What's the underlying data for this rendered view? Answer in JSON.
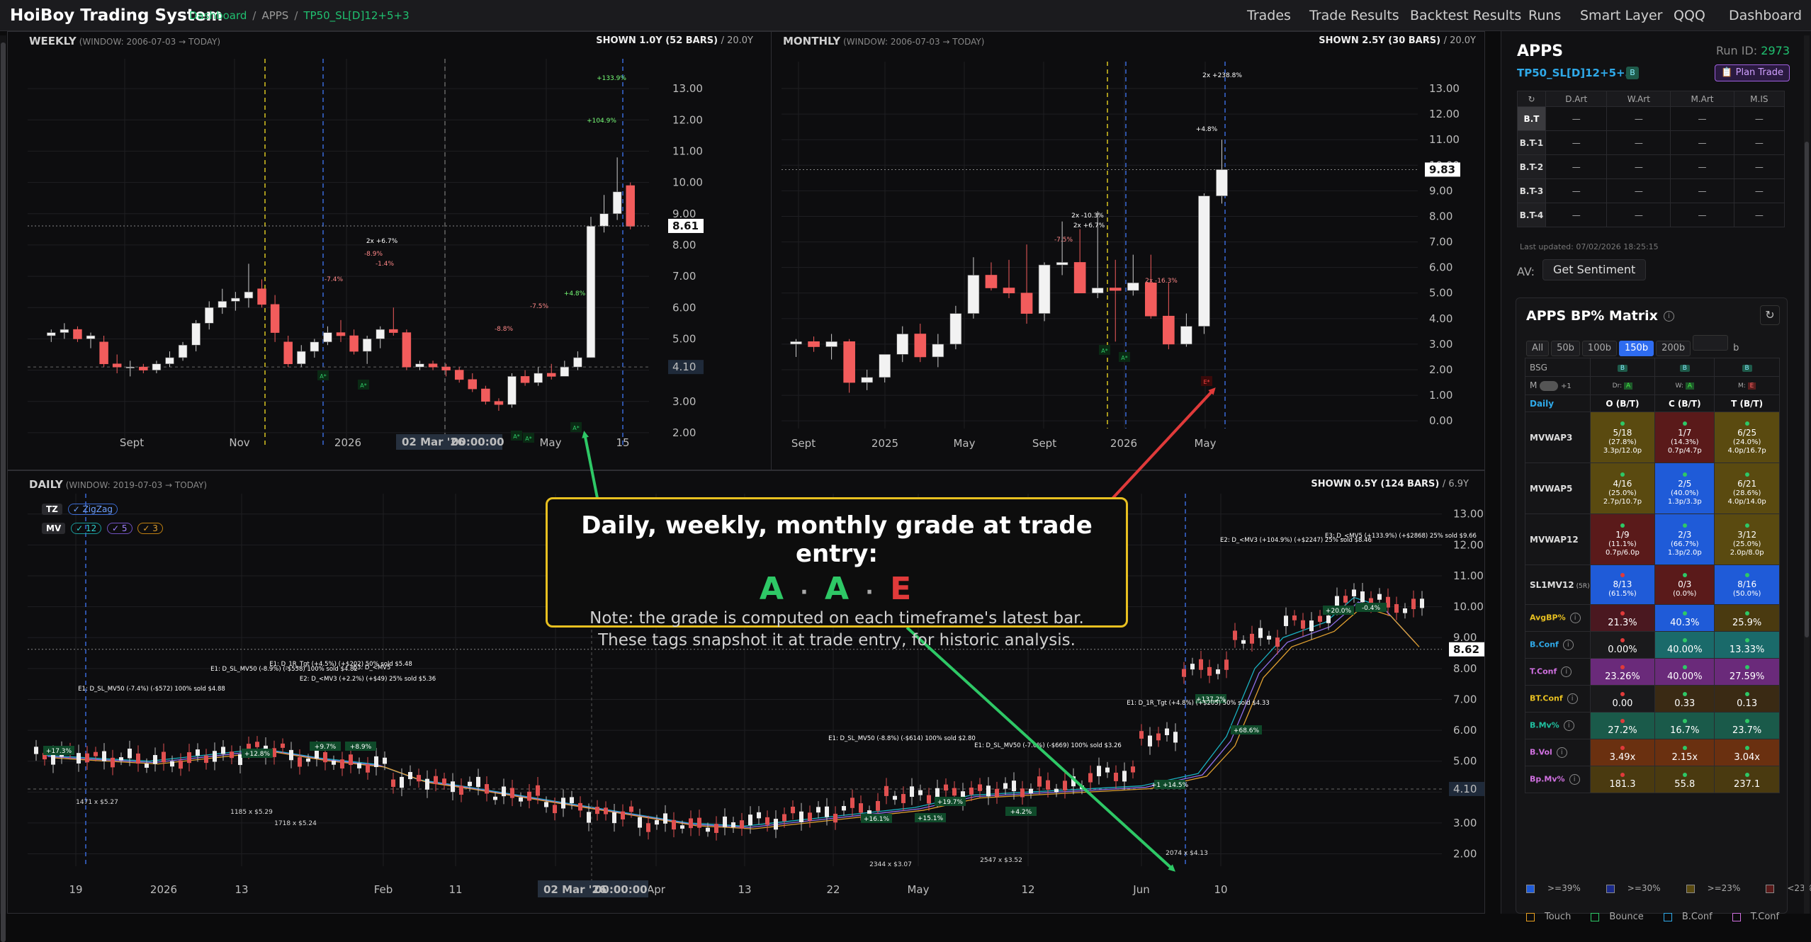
{
  "app": {
    "brand": "HoiBoy Trading System",
    "crumb_dashboard": "Dashboard",
    "crumb_apps": "APPS",
    "crumb_strategy": "TP50_SL[D]12+5+3"
  },
  "nav": [
    "Trades",
    "Trade Results",
    "Backtest Results",
    "Runs",
    "Smart Layer",
    "QQQ",
    "Dashboard"
  ],
  "weekly": {
    "title": "WEEKLY",
    "window": "(WINDOW: 2006-07-03 → TODAY)",
    "shown": "SHOWN 1.0Y (52 BARS)",
    "span": "/ 20.0Y",
    "last_price": "8.61",
    "level": "4.10",
    "crosshair_date": "02 Mar '26",
    "crosshair_time": "00:00:00"
  },
  "monthly": {
    "title": "MONTHLY",
    "window": "(WINDOW: 2006-07-03 → TODAY)",
    "shown": "SHOWN 2.5Y (30 BARS)",
    "span": "/ 20.0Y",
    "last_price": "9.83"
  },
  "daily": {
    "title": "DAILY",
    "window": "(WINDOW: 2019-07-03 → TODAY)",
    "shown": "SHOWN 0.5Y (124 BARS)",
    "span": "/ 6.9Y",
    "last_price": "8.62",
    "level": "4.10",
    "crosshair_date": "02 Mar '26",
    "crosshair_time": "00:00:00",
    "tags": {
      "tz": "TZ",
      "zigzag": "✓ ZigZag",
      "mv": "MV",
      "mv12": "✓ 12",
      "mv5": "✓ 5",
      "mv3": "✓ 3"
    }
  },
  "callout": {
    "heading": "Daily, weekly, monthly grade at trade entry:",
    "grade_daily": "A",
    "grade_weekly": "A",
    "grade_monthly": "E",
    "dot": "·",
    "note1": "Note: the grade is computed on each timeframe's latest bar.",
    "note2": "These tags snapshot it at trade entry, for historic analysis.",
    "color_a": "#2ec866",
    "color_e": "#e03a3a"
  },
  "chart_data": [
    {
      "id": "weekly",
      "type": "candlestick",
      "title": "WEEKLY",
      "x_ticks": [
        "Sept",
        "Nov",
        "2026",
        "May",
        "15"
      ],
      "y_ticks": [
        "2.00",
        "3.00",
        "4.00",
        "5.00",
        "6.00",
        "7.00",
        "8.00",
        "9.00",
        "10.00",
        "11.00",
        "12.00",
        "13.00"
      ],
      "ylim": [
        1.5,
        13.5
      ],
      "candles": [
        [
          5.1,
          5.3,
          4.9,
          5.2
        ],
        [
          5.2,
          5.5,
          5.0,
          5.3
        ],
        [
          5.3,
          5.4,
          4.9,
          5.0
        ],
        [
          5.0,
          5.2,
          4.7,
          5.1
        ],
        [
          4.9,
          5.1,
          4.1,
          4.2
        ],
        [
          4.2,
          4.5,
          3.9,
          4.1
        ],
        [
          4.1,
          4.3,
          3.8,
          4.1
        ],
        [
          4.1,
          4.2,
          3.9,
          4.0
        ],
        [
          4.0,
          4.3,
          3.9,
          4.2
        ],
        [
          4.2,
          4.6,
          4.1,
          4.4
        ],
        [
          4.4,
          4.9,
          4.3,
          4.8
        ],
        [
          4.8,
          5.6,
          4.6,
          5.5
        ],
        [
          5.5,
          6.2,
          5.3,
          6.0
        ],
        [
          6.0,
          6.6,
          5.8,
          6.2
        ],
        [
          6.2,
          6.5,
          5.9,
          6.3
        ],
        [
          6.3,
          7.4,
          6.0,
          6.5
        ],
        [
          6.6,
          6.9,
          6.0,
          6.1
        ],
        [
          6.1,
          6.4,
          4.9,
          5.2
        ],
        [
          4.9,
          5.1,
          4.1,
          4.2
        ],
        [
          4.2,
          4.8,
          4.1,
          4.6
        ],
        [
          4.6,
          5.0,
          4.4,
          4.9
        ],
        [
          4.9,
          5.4,
          4.8,
          5.2
        ],
        [
          5.2,
          5.6,
          4.9,
          5.1
        ],
        [
          5.1,
          5.3,
          4.5,
          4.6
        ],
        [
          4.6,
          5.1,
          4.2,
          5.0
        ],
        [
          5.0,
          5.4,
          4.7,
          5.3
        ],
        [
          5.3,
          6.0,
          5.1,
          5.2
        ],
        [
          5.2,
          5.3,
          4.0,
          4.1
        ],
        [
          4.1,
          4.3,
          4.0,
          4.2
        ],
        [
          4.2,
          4.3,
          4.0,
          4.1
        ],
        [
          4.1,
          4.2,
          3.8,
          4.0
        ],
        [
          4.0,
          4.1,
          3.6,
          3.7
        ],
        [
          3.7,
          3.9,
          3.3,
          3.4
        ],
        [
          3.4,
          3.5,
          2.9,
          3.0
        ],
        [
          3.0,
          3.1,
          2.7,
          2.9
        ],
        [
          2.9,
          3.9,
          2.8,
          3.8
        ],
        [
          3.8,
          4.0,
          3.5,
          3.6
        ],
        [
          3.6,
          4.1,
          3.5,
          3.9
        ],
        [
          3.9,
          4.2,
          3.7,
          3.8
        ],
        [
          3.8,
          4.3,
          3.8,
          4.1
        ],
        [
          4.1,
          4.6,
          4.0,
          4.4
        ],
        [
          4.4,
          8.9,
          4.4,
          8.6
        ],
        [
          8.6,
          9.6,
          8.4,
          9.0
        ],
        [
          9.0,
          10.8,
          8.8,
          9.7
        ],
        [
          9.9,
          10.0,
          8.5,
          8.6
        ]
      ],
      "annotations": [
        "-7.4%",
        "2x +6.7%",
        "-8.9%",
        "-1.4%",
        "-7.5%",
        "-8.8%",
        "+4.8%",
        "+104.9%",
        "+133.9%"
      ]
    },
    {
      "id": "monthly",
      "type": "candlestick",
      "title": "MONTHLY",
      "x_ticks": [
        "Sept",
        "2025",
        "May",
        "Sept",
        "2026",
        "May"
      ],
      "y_ticks": [
        "0.00",
        "1.00",
        "2.00",
        "3.00",
        "4.00",
        "5.00",
        "6.00",
        "7.00",
        "8.00",
        "9.00",
        "10.00",
        "11.00",
        "12.00",
        "13.00"
      ],
      "ylim": [
        -0.3,
        13.5
      ],
      "candles": [
        [
          3.0,
          3.2,
          2.5,
          3.1
        ],
        [
          3.1,
          3.3,
          2.7,
          2.9
        ],
        [
          2.9,
          3.4,
          2.4,
          3.1
        ],
        [
          3.1,
          3.2,
          1.1,
          1.5
        ],
        [
          1.5,
          2.0,
          1.2,
          1.7
        ],
        [
          1.7,
          2.5,
          1.5,
          2.6
        ],
        [
          2.6,
          3.7,
          2.3,
          3.4
        ],
        [
          3.4,
          3.8,
          2.3,
          2.5
        ],
        [
          2.5,
          3.4,
          2.1,
          3.0
        ],
        [
          3.0,
          4.5,
          2.8,
          4.2
        ],
        [
          4.2,
          6.4,
          4.0,
          5.7
        ],
        [
          5.7,
          6.2,
          5.1,
          5.2
        ],
        [
          5.2,
          6.3,
          4.8,
          5.0
        ],
        [
          5.0,
          6.9,
          3.8,
          4.2
        ],
        [
          4.2,
          6.2,
          3.9,
          6.1
        ],
        [
          6.1,
          7.8,
          5.7,
          6.2
        ],
        [
          6.2,
          7.5,
          5.5,
          5.0
        ],
        [
          5.0,
          8.2,
          4.8,
          5.2
        ],
        [
          5.2,
          6.3,
          3.1,
          5.1
        ],
        [
          5.1,
          6.5,
          4.9,
          5.4
        ],
        [
          5.4,
          6.5,
          4.0,
          4.1
        ],
        [
          4.1,
          5.4,
          2.8,
          3.0
        ],
        [
          3.0,
          4.2,
          2.9,
          3.7
        ],
        [
          3.7,
          8.9,
          3.4,
          8.8
        ],
        [
          8.8,
          11.0,
          8.5,
          9.83
        ]
      ],
      "annotations": [
        "-7.5%",
        "2x -10.3%",
        "2x +6.7%",
        "2x -16.3%",
        "+4.8%",
        "2x +238.8%"
      ]
    },
    {
      "id": "daily",
      "type": "candlestick",
      "title": "DAILY",
      "x_ticks": [
        "19",
        "2026",
        "13",
        "Feb",
        "11",
        "20",
        "Apr",
        "13",
        "22",
        "May",
        "12",
        "Jun",
        "10"
      ],
      "y_ticks": [
        "2.00",
        "3.00",
        "4.00",
        "5.00",
        "6.00",
        "7.00",
        "8.00",
        "9.00",
        "10.00",
        "11.00",
        "12.00",
        "13.00"
      ],
      "ylim": [
        1.6,
        13.2
      ],
      "annotations": [
        "+17.3%",
        "+12.8%",
        "+9.7%",
        "+8.9%",
        "+16.1%",
        "+15.1%",
        "+19.7%",
        "+4.2%",
        "+1 +14.5%",
        "+137.2%",
        "+68.6%",
        "+20.0%",
        "-0.4%"
      ],
      "trade_labels": [
        "E1: D_SL_MV50 (-7.4%) (-$572) 100% sold $4.88",
        "E1: D_SL_MV50 (-8.9%) (-$558) 100% sold $4.82",
        "E1: D_1R_Tgt (+4.5%) (+$202) 50% sold $5.48",
        "E2: D_<MV3 (+2.2%) (+$49) 25% sold $5.36",
        "E3: D_<MV5",
        "E1: D_SL_MV50 (-8.8%) (-$614) 100% sold $2.80",
        "E1: D_SL_MV50 (-7.0%) (-$669) 100% sold $3.26",
        "E1: D_1R_Tgt (+4.8%) (+$205) 50% sold $4.33",
        "E2: D_<MV3 (+104.9%) (+$2247) 25% sold $8.46",
        "E3: D_<MV5 (+133.9%) (+$2868) 25% sold $9.66"
      ],
      "entries": [
        "1471 x $5.27",
        "1185 x $5.29",
        "1718 x $5.24",
        "2344 x $3.07",
        "2547 x $3.52",
        "2074 x $4.13"
      ]
    }
  ],
  "side": {
    "title": "APPS",
    "run_label": "Run ID:",
    "run_id": "2973",
    "strategy": "TP50_SL[D]12+5+3",
    "b_badge": "B",
    "plan_btn": "📋 Plan Trade",
    "ct_headers": [
      "↻",
      "D.Art",
      "W.Art",
      "M.Art",
      "M.IS"
    ],
    "ct_rows": [
      [
        "B.T",
        "—",
        "—",
        "—",
        "—"
      ],
      [
        "B.T-1",
        "—",
        "—",
        "—",
        "—"
      ],
      [
        "B.T-2",
        "—",
        "—",
        "—",
        "—"
      ],
      [
        "B.T-3",
        "—",
        "—",
        "—",
        "—"
      ],
      [
        "B.T-4",
        "—",
        "—",
        "—",
        "—"
      ]
    ],
    "updated": "Last updated: 07/02/2026 18:25:15",
    "av": "AV:",
    "sentiment_btn": "Get Sentiment",
    "matrix_title": "APPS BP% Matrix",
    "tabs": [
      "All",
      "50b",
      "100b",
      "150b",
      "200b"
    ],
    "tab_unit": "b",
    "bsg": "BSG",
    "m_label": "M",
    "m_plus": "+1",
    "daily_lbl": "Daily",
    "col_o": "O (B/T)",
    "col_c": "C (B/T)",
    "col_t": "T (B/T)",
    "grade_d": "Dr",
    "grade_d_v": "A",
    "grade_w": "W",
    "grade_w_v": "A",
    "grade_m": "M",
    "grade_m_v": "E",
    "rows": [
      {
        "label": "MVWAP3",
        "cells": [
          [
            "5/18",
            "(27.8%)",
            "3.3p/12.0p"
          ],
          [
            "1/7",
            "(14.3%)",
            "0.7p/4.7p"
          ],
          [
            "6/25",
            "(24.0%)",
            "4.0p/16.7p"
          ]
        ],
        "bg": [
          "#5a4a10",
          "#5a1a1a",
          "#5a4a10"
        ]
      },
      {
        "label": "MVWAP5",
        "cells": [
          [
            "4/16",
            "(25.0%)",
            "2.7p/10.7p"
          ],
          [
            "2/5",
            "(40.0%)",
            "1.3p/3.3p"
          ],
          [
            "6/21",
            "(28.6%)",
            "4.0p/14.0p"
          ]
        ],
        "bg": [
          "#5a4a10",
          "#1f5bd8",
          "#5a4a10"
        ]
      },
      {
        "label": "MVWAP12",
        "cells": [
          [
            "1/9",
            "(11.1%)",
            "0.7p/6.0p"
          ],
          [
            "2/3",
            "(66.7%)",
            "1.3p/2.0p"
          ],
          [
            "3/12",
            "(25.0%)",
            "2.0p/8.0p"
          ]
        ],
        "bg": [
          "#5a1a1a",
          "#1f5bd8",
          "#5a4a10"
        ]
      },
      {
        "label": "SL1MV12",
        "sub": "(5R)",
        "cells": [
          [
            "8/13",
            "(61.5%)",
            ""
          ],
          [
            "0/3",
            "(0.0%)",
            ""
          ],
          [
            "8/16",
            "(50.0%)",
            ""
          ]
        ],
        "bg": [
          "#1f5bd8",
          "#5a1a1a",
          "#1f5bd8"
        ]
      }
    ],
    "stats": [
      {
        "label": "AvgBP%",
        "vals": [
          "21.3%",
          "40.3%",
          "25.9%"
        ],
        "bg": [
          "#4a1820",
          "#1f5bd8",
          "#4a3a10"
        ],
        "lc": "#e8c020"
      },
      {
        "label": "B.Conf",
        "vals": [
          "0.00%",
          "40.00%",
          "13.33%"
        ],
        "bg": [
          "#1a1a1c",
          "#1a6a6a",
          "#1a6a6a"
        ],
        "lc": "#2fa9e8"
      },
      {
        "label": "T.Conf",
        "vals": [
          "23.26%",
          "40.00%",
          "27.59%"
        ],
        "bg": [
          "#6a2a7a",
          "#6a2a7a",
          "#6a2a7a"
        ],
        "lc": "#d070e0"
      },
      {
        "label": "BT.Conf",
        "vals": [
          "0.00",
          "0.33",
          "0.13"
        ],
        "bg": [
          "#1a1a1c",
          "#3a2a14",
          "#3a2a14"
        ],
        "lc": "#e8c020"
      },
      {
        "label": "B.Mv%",
        "vals": [
          "27.2%",
          "16.7%",
          "23.7%"
        ],
        "bg": [
          "#1a5a4a",
          "#1a5a4a",
          "#1a5a4a"
        ],
        "lc": "#20c0a0"
      },
      {
        "label": "B.Vol",
        "vals": [
          "3.49x",
          "2.15x",
          "3.04x"
        ],
        "bg": [
          "#6a3010",
          "#6a3010",
          "#6a3010"
        ],
        "lc": "#d070e0"
      },
      {
        "label": "Bp.Mv%",
        "vals": [
          "181.3",
          "55.8",
          "237.1"
        ],
        "bg": [
          "#4a3a10",
          "#4a3a10",
          "#4a3a10"
        ],
        "lc": "#d070e0"
      }
    ],
    "legend1": [
      ">=39%",
      ">=30%",
      ">=23%",
      "<23%"
    ],
    "legend2": [
      "Touch",
      "Bounce",
      "B.Conf",
      "T.Conf"
    ]
  }
}
